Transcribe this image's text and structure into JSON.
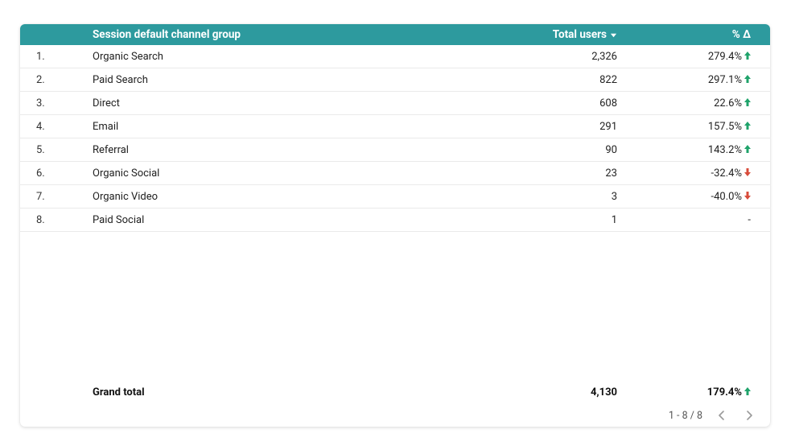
{
  "chart_data": {
    "type": "table",
    "columns": [
      "Session default channel group",
      "Total users",
      "% Δ"
    ],
    "rows": [
      {
        "rank": 1,
        "channel": "Organic Search",
        "users": 2326,
        "delta_pct": 279.4,
        "direction": "up"
      },
      {
        "rank": 2,
        "channel": "Paid Search",
        "users": 822,
        "delta_pct": 297.1,
        "direction": "up"
      },
      {
        "rank": 3,
        "channel": "Direct",
        "users": 608,
        "delta_pct": 22.6,
        "direction": "up"
      },
      {
        "rank": 4,
        "channel": "Email",
        "users": 291,
        "delta_pct": 157.5,
        "direction": "up"
      },
      {
        "rank": 5,
        "channel": "Referral",
        "users": 90,
        "delta_pct": 143.2,
        "direction": "up"
      },
      {
        "rank": 6,
        "channel": "Organic Social",
        "users": 23,
        "delta_pct": -32.4,
        "direction": "down"
      },
      {
        "rank": 7,
        "channel": "Organic Video",
        "users": 3,
        "delta_pct": -40.0,
        "direction": "down"
      },
      {
        "rank": 8,
        "channel": "Paid Social",
        "users": 1,
        "delta_pct": null,
        "direction": null
      }
    ],
    "grand_total": {
      "users": 4130,
      "delta_pct": 179.4,
      "direction": "up"
    }
  },
  "header": {
    "channel": "Session default channel group",
    "users": "Total users",
    "delta": "% Δ"
  },
  "rows": [
    {
      "idx": "1.",
      "channel": "Organic Search",
      "users": "2,326",
      "delta": "279.4%",
      "dir": "up"
    },
    {
      "idx": "2.",
      "channel": "Paid Search",
      "users": "822",
      "delta": "297.1%",
      "dir": "up"
    },
    {
      "idx": "3.",
      "channel": "Direct",
      "users": "608",
      "delta": "22.6%",
      "dir": "up"
    },
    {
      "idx": "4.",
      "channel": "Email",
      "users": "291",
      "delta": "157.5%",
      "dir": "up"
    },
    {
      "idx": "5.",
      "channel": "Referral",
      "users": "90",
      "delta": "143.2%",
      "dir": "up"
    },
    {
      "idx": "6.",
      "channel": "Organic Social",
      "users": "23",
      "delta": "-32.4%",
      "dir": "down"
    },
    {
      "idx": "7.",
      "channel": "Organic Video",
      "users": "3",
      "delta": "-40.0%",
      "dir": "down"
    },
    {
      "idx": "8.",
      "channel": "Paid Social",
      "users": "1",
      "delta": "-",
      "dir": "none"
    }
  ],
  "grand": {
    "label": "Grand total",
    "users": "4,130",
    "delta": "179.4%",
    "dir": "up"
  },
  "pager": {
    "range": "1 - 8 / 8"
  }
}
